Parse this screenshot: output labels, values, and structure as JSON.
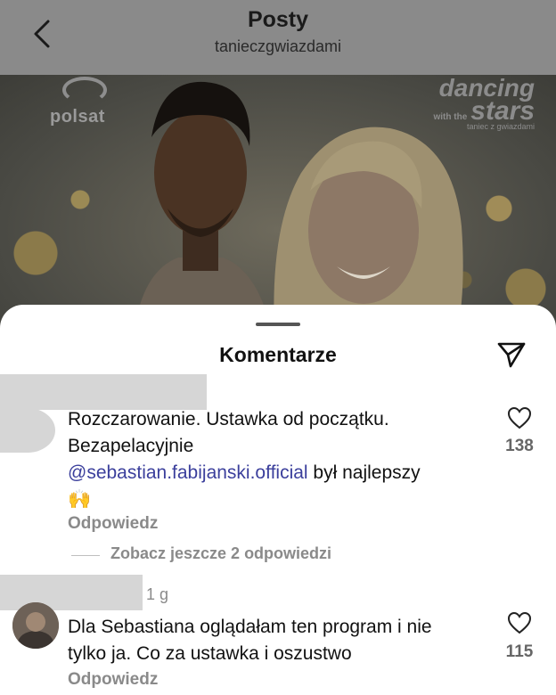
{
  "header": {
    "title": "Posty",
    "account": "tanieczgwiazdami"
  },
  "photo": {
    "logo_left": "polsat",
    "logo_right_1": "dancing",
    "logo_right_2": "with the",
    "logo_right_3": "stars",
    "logo_right_4": "taniec z gwiazdami"
  },
  "comments_panel": {
    "title": "Komentarze"
  },
  "comments": [
    {
      "text_line1": "Rozczarowanie. Ustawka od początku.",
      "text_line2": "Bezapelacyjnie",
      "mention": "@sebastian.fabijanski.official",
      "text_after_mention": " był najlepszy",
      "emoji": "🙌",
      "likes": "138",
      "reply_label": "Odpowiedz",
      "view_more": "Zobacz jeszcze 2 odpowiedzi"
    },
    {
      "time": "1 g",
      "text_line1": "Dla Sebastiana oglądałam ten program i nie",
      "text_line2": "tylko ja. Co za ustawka i oszustwo",
      "likes": "115",
      "reply_label": "Odpowiedz"
    }
  ]
}
